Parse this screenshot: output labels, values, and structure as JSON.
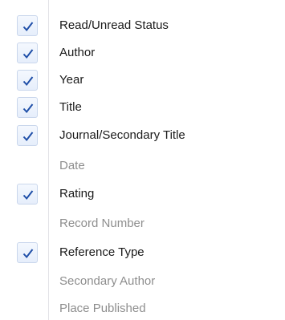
{
  "menu": {
    "items": [
      {
        "label": "Read/Unread Status",
        "checked": true,
        "enabled": true
      },
      {
        "label": "Author",
        "checked": true,
        "enabled": true
      },
      {
        "label": "Year",
        "checked": true,
        "enabled": true
      },
      {
        "label": "Title",
        "checked": true,
        "enabled": true
      },
      {
        "label": "Journal/Secondary Title",
        "checked": true,
        "enabled": true
      },
      {
        "label": "Date",
        "checked": false,
        "enabled": false
      },
      {
        "label": "Rating",
        "checked": true,
        "enabled": true
      },
      {
        "label": "Record Number",
        "checked": false,
        "enabled": false
      },
      {
        "label": "Reference Type",
        "checked": true,
        "enabled": true
      },
      {
        "label": "Secondary Author",
        "checked": false,
        "enabled": false
      },
      {
        "label": "Place Published",
        "checked": false,
        "enabled": false
      }
    ],
    "check_icon": "checkmark-icon",
    "colors": {
      "check": "#1f4fa8",
      "text": "#1a1a1a",
      "disabled_text": "#8e8e8e",
      "checkbox_border": "#c9d6ec"
    }
  }
}
